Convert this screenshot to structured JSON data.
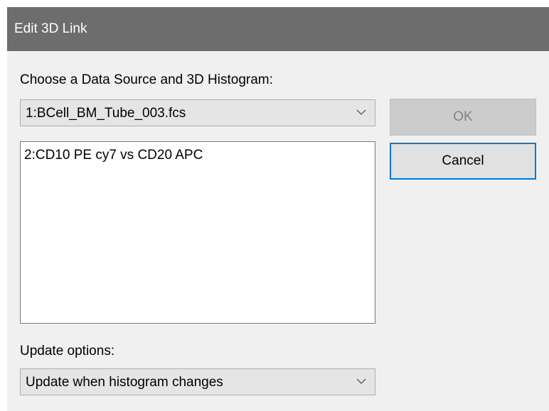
{
  "window": {
    "title": "Edit 3D Link"
  },
  "source": {
    "label": "Choose a Data Source and 3D Histogram:",
    "selected": "1:BCell_BM_Tube_003.fcs"
  },
  "histograms": {
    "items": [
      "2:CD10 PE cy7 vs CD20 APC"
    ]
  },
  "update": {
    "label": "Update options:",
    "selected": "Update when histogram changes"
  },
  "buttons": {
    "ok_label": "OK",
    "cancel_label": "Cancel"
  },
  "colors": {
    "titlebar": "#6d6d6d",
    "dialog_bg": "#f0f0f0",
    "focus_border": "#0078d7",
    "disabled_text": "#838383"
  },
  "icons": {
    "dropdown": "chevron-down-icon"
  }
}
